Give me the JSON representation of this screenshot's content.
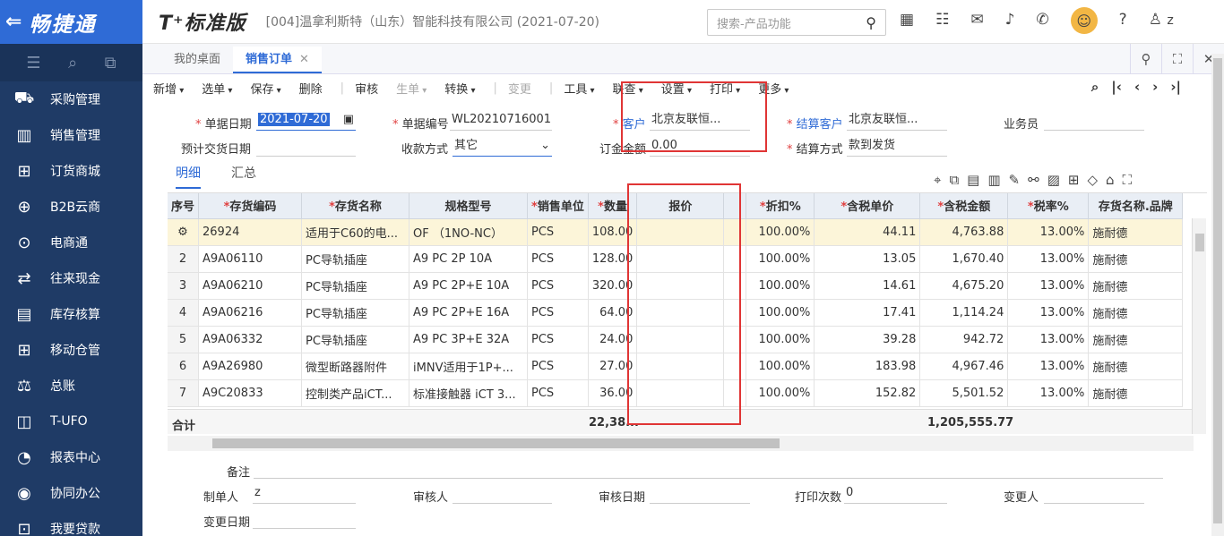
{
  "sidebar": {
    "brand": "畅捷通",
    "items": [
      {
        "label": "采购管理",
        "icon": "purchase-icon"
      },
      {
        "label": "销售管理",
        "icon": "sales-icon"
      },
      {
        "label": "订货商城",
        "icon": "mall-icon"
      },
      {
        "label": "B2B云商",
        "icon": "b2b-icon"
      },
      {
        "label": "电商通",
        "icon": "ecommerce-icon"
      },
      {
        "label": "往来现金",
        "icon": "cash-icon"
      },
      {
        "label": "库存核算",
        "icon": "inventory-icon"
      },
      {
        "label": "移动仓管",
        "icon": "mobile-warehouse-icon"
      },
      {
        "label": "总账",
        "icon": "ledger-icon"
      },
      {
        "label": "T-UFO",
        "icon": "ufo-icon"
      },
      {
        "label": "报表中心",
        "icon": "report-icon"
      },
      {
        "label": "协同办公",
        "icon": "office-icon"
      },
      {
        "label": "我要贷款",
        "icon": "loan-icon"
      }
    ]
  },
  "header": {
    "logo": "T⁺标准版",
    "company": "[004]温拿利斯特（山东）智能科技有限公司   (2021-07-20)",
    "search_placeholder": "搜索-产品功能",
    "user": "z"
  },
  "tabs": [
    {
      "label": "我的桌面"
    },
    {
      "label": "销售订单"
    }
  ],
  "toolbar": {
    "items": [
      "新增",
      "选单",
      "保存",
      "删除",
      "审核",
      "生单",
      "转换",
      "变更",
      "工具",
      "联查",
      "设置",
      "打印",
      "更多"
    ]
  },
  "form": {
    "date_label": "单据日期",
    "date_value": "2021-07-20",
    "code_label": "单据编号",
    "code_value": "WL20210716001",
    "customer_label": "客户",
    "customer_value": "北京友联恒...",
    "settle_customer_label": "结算客户",
    "settle_customer_value": "北京友联恒...",
    "salesman_label": "业务员",
    "delivery_label": "预计交货日期",
    "payment_label": "收款方式",
    "payment_value": "其它",
    "deposit_label": "订金金额",
    "deposit_value": "0.00",
    "settle_method_label": "结算方式",
    "settle_method_value": "款到发货"
  },
  "subtabs": [
    "明细",
    "汇总"
  ],
  "grid": {
    "headers": [
      "序号",
      "存货编码",
      "存货名称",
      "规格型号",
      "销售单位",
      "数量",
      "报价",
      "",
      "折扣%",
      "含税单价",
      "含税金额",
      "税率%",
      "存货名称.品牌"
    ],
    "rows": [
      [
        "",
        "26924",
        "适用于C60的电...",
        "OF （1NO-NC）",
        "PCS",
        "108.00",
        "",
        "",
        "100.00%",
        "44.11",
        "4,763.88",
        "13.00%",
        "施耐德"
      ],
      [
        "2",
        "A9A06110",
        "PC导轨插座",
        "A9 PC 2P 10A",
        "PCS",
        "128.00",
        "",
        "",
        "100.00%",
        "13.05",
        "1,670.40",
        "13.00%",
        "施耐德"
      ],
      [
        "3",
        "A9A06210",
        "PC导轨插座",
        "A9 PC 2P+E 10A",
        "PCS",
        "320.00",
        "",
        "",
        "100.00%",
        "14.61",
        "4,675.20",
        "13.00%",
        "施耐德"
      ],
      [
        "4",
        "A9A06216",
        "PC导轨插座",
        "A9 PC 2P+E 16A",
        "PCS",
        "64.00",
        "",
        "",
        "100.00%",
        "17.41",
        "1,114.24",
        "13.00%",
        "施耐德"
      ],
      [
        "5",
        "A9A06332",
        "PC导轨插座",
        "A9 PC 3P+E 32A",
        "PCS",
        "24.00",
        "",
        "",
        "100.00%",
        "39.28",
        "942.72",
        "13.00%",
        "施耐德"
      ],
      [
        "6",
        "A9A26980",
        "微型断路器附件",
        "iMNV适用于1P+...",
        "PCS",
        "27.00",
        "",
        "",
        "100.00%",
        "183.98",
        "4,967.46",
        "13.00%",
        "施耐德"
      ],
      [
        "7",
        "A9C20833",
        "控制类产品iCT...",
        "标准接触器 iCT 3...",
        "PCS",
        "36.00",
        "",
        "",
        "100.00%",
        "152.82",
        "5,501.52",
        "13.00%",
        "施耐德"
      ]
    ],
    "sum_label": "合计",
    "sum_qty": "22,38...",
    "sum_amount": "1,205,555.77"
  },
  "footer": {
    "remark_label": "备注",
    "maker_label": "制单人",
    "maker_value": "z",
    "auditor_label": "审核人",
    "audit_date_label": "审核日期",
    "print_count_label": "打印次数",
    "print_count_value": "0",
    "changer_label": "变更人",
    "change_date_label": "变更日期"
  }
}
